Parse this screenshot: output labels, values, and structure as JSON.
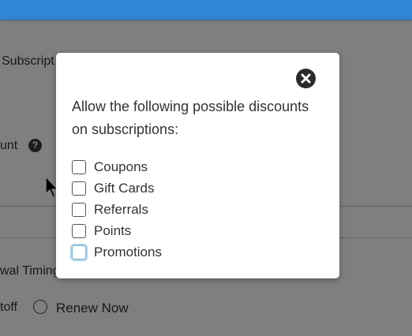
{
  "background": {
    "subscript_fragment": "Subscript",
    "count_fragment": "unt",
    "renewal_fragment": "wal Timing",
    "toff_fragment": "toff",
    "renew_now_label": "Renew Now",
    "help_glyph": "?"
  },
  "modal": {
    "prompt": "Allow the following possible discounts on subscriptions:",
    "options": [
      {
        "label": "Coupons",
        "checked": false,
        "focused": false
      },
      {
        "label": "Gift Cards",
        "checked": false,
        "focused": false
      },
      {
        "label": "Referrals",
        "checked": false,
        "focused": false
      },
      {
        "label": "Points",
        "checked": false,
        "focused": false
      },
      {
        "label": "Promotions",
        "checked": false,
        "focused": true
      }
    ]
  },
  "colors": {
    "topbar": "#2f86d6",
    "focus_ring": "#a8d4f2"
  }
}
